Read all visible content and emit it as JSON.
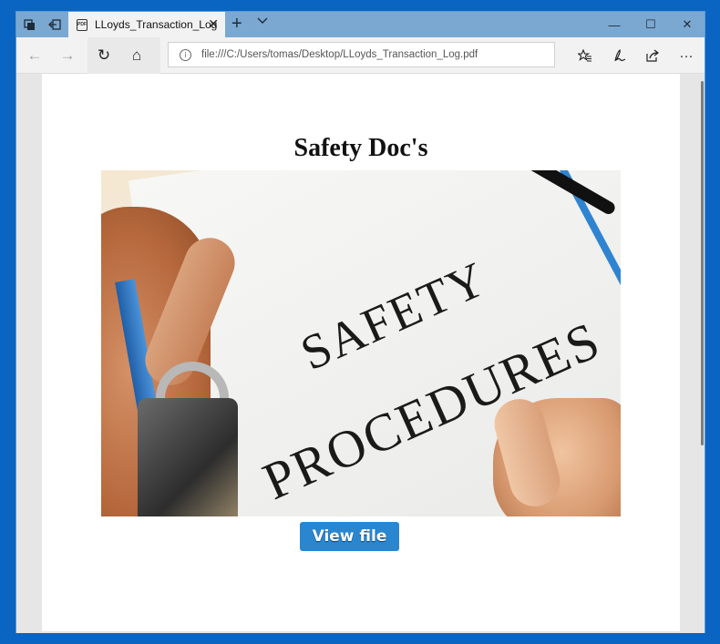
{
  "browser": {
    "tab": {
      "title": "LLoyds_Transaction_Log",
      "icon": "pdf-file-icon",
      "close_icon": "close-icon"
    },
    "tabbar_buttons": [
      {
        "name": "set-tabs-aside-button",
        "icon": "tabs-aside-icon",
        "glyph": "⧉"
      },
      {
        "name": "restore-tabs-button",
        "icon": "restore-tabs-icon",
        "glyph": "⇤"
      }
    ],
    "new_tab_glyph": "+",
    "window_controls": {
      "minimize": "—",
      "maximize": "☐",
      "close": "✕"
    },
    "toolbar": {
      "back_glyph": "←",
      "forward_glyph": "→",
      "refresh_glyph": "↻",
      "home_glyph": "⌂",
      "address": "file:///C:/Users/tomas/Desktop/LLoyds_Transaction_Log.pdf",
      "info_glyph": "i",
      "favorites_glyph": "☆≡",
      "notes_glyph": "✎",
      "share_glyph": "⇪",
      "more_glyph": "···"
    }
  },
  "document": {
    "title": "Safety Doc's",
    "image_text": {
      "line1": "SAFETY",
      "line2": "PROCEDURES"
    },
    "button_label": "View file"
  }
}
